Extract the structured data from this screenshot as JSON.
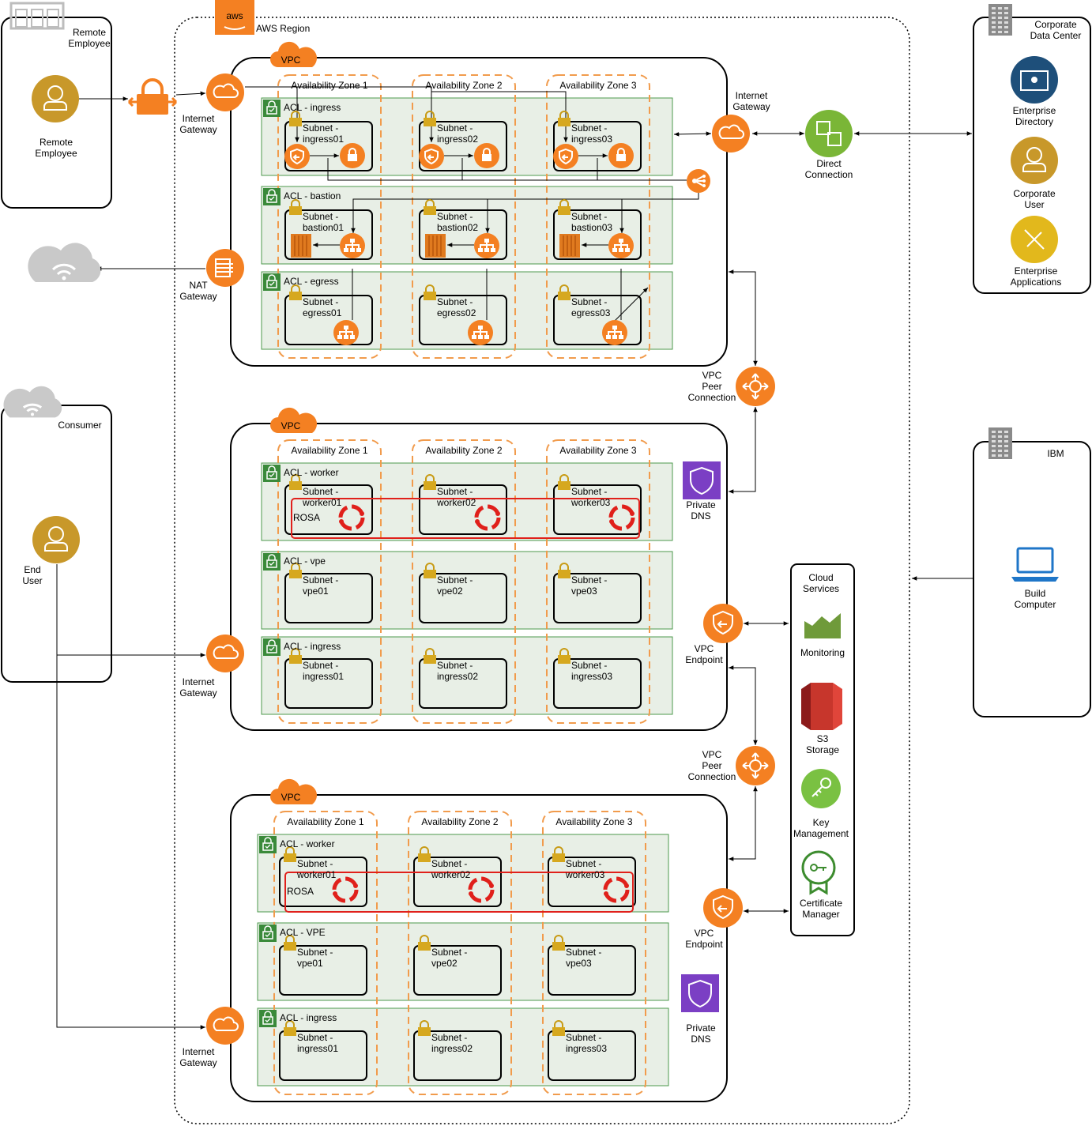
{
  "colors": {
    "aws_orange": "#f48022",
    "acl_green": "#4c9a4c",
    "acl_fill": "#e8efe6",
    "rosa_red": "#e0201b",
    "person_gold": "#c8982a",
    "r53_purple": "#7b3fc4",
    "vpc_orange": "#f48022"
  },
  "aws": {
    "logo": "aws",
    "region_label": "AWS Region"
  },
  "remote": {
    "title": "Remote\nEmployee",
    "user_label": "Remote\nEmployee"
  },
  "consumer": {
    "title": "Consumer",
    "user_label": "End\nUser"
  },
  "corporate": {
    "title": "Corporate\nData Center",
    "items": [
      "Enterprise\nDirectory",
      "Corporate\nUser",
      "Enterprise\nApplications"
    ]
  },
  "ibm": {
    "title": "IBM",
    "item": "Build\nComputer"
  },
  "cloud_services": {
    "title": "Cloud\nServices",
    "items": [
      "Monitoring",
      "S3\nStorage",
      "Key\nManagement",
      "Certificate\nManager"
    ]
  },
  "labels": {
    "vpc": "VPC",
    "internet_gateway": "Internet\nGateway",
    "nat_gateway": "NAT\nGateway",
    "direct_connection": "Direct\nConnection",
    "vpc_peer": "VPC\nPeer\nConnection",
    "vpc_endpoint": "VPC\nEndpoint",
    "private_dns": "Private\nDNS",
    "rosa": "ROSA",
    "subnet_prefix": "Subnet -",
    "az": [
      "Availability Zone 1",
      "Availability Zone 2",
      "Availability Zone 3"
    ]
  },
  "vpc1": {
    "acls": [
      {
        "name": "ACL - ingress",
        "subnets": [
          "ingress01",
          "ingress02",
          "ingress03"
        ]
      },
      {
        "name": "ACL - bastion",
        "subnets": [
          "bastion01",
          "bastion02",
          "bastion03"
        ]
      },
      {
        "name": "ACL - egress",
        "subnets": [
          "egress01",
          "egress02",
          "egress03"
        ]
      }
    ]
  },
  "vpc2": {
    "acls": [
      {
        "name": "ACL - worker",
        "subnets": [
          "worker01",
          "worker02",
          "worker03"
        ]
      },
      {
        "name": "ACL - vpe",
        "subnets": [
          "vpe01",
          "vpe02",
          "vpe03"
        ]
      },
      {
        "name": "ACL - ingress",
        "subnets": [
          "ingress01",
          "ingress02",
          "ingress03"
        ]
      }
    ]
  },
  "vpc3": {
    "acls": [
      {
        "name": "ACL - worker",
        "subnets": [
          "worker01",
          "worker02",
          "worker03"
        ]
      },
      {
        "name": "ACL - VPE",
        "subnets": [
          "vpe01",
          "vpe02",
          "vpe03"
        ]
      },
      {
        "name": "ACL - ingress",
        "subnets": [
          "ingress01",
          "ingress02",
          "ingress03"
        ]
      }
    ]
  }
}
